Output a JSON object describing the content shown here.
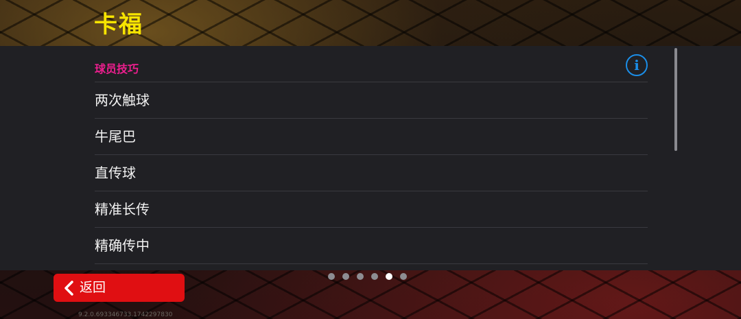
{
  "header": {
    "title": "卡福"
  },
  "panel": {
    "section_label": "球员技巧",
    "info_button": {
      "icon": "info-icon",
      "glyph": "i",
      "color": "#1b8ee8"
    },
    "skills": [
      "两次触球",
      "牛尾巴",
      "直传球",
      "精准长传",
      "精确传中"
    ]
  },
  "pagination": {
    "total": 6,
    "active_page": 5
  },
  "footer": {
    "back_label": "返回",
    "back_icon": "chevron-left-icon",
    "version": "9.2.0.693346733.1742297830"
  },
  "colors": {
    "title": "#f7e400",
    "section_label": "#ec1e8e",
    "back_button": "#e00f12",
    "panel": "#202024"
  }
}
